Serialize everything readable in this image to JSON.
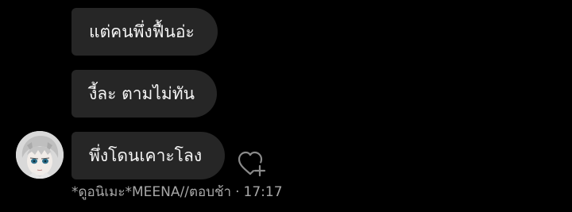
{
  "messages": [
    {
      "text": "แต่คนพึ่งฟื้นอ่ะ"
    },
    {
      "text": "งี้ละ ตามไม่ทัน"
    },
    {
      "text": "พึ่งโดนเคาะโลง"
    }
  ],
  "sender": {
    "name": "*ดูอนิเมะ*MEENA//ตอบช้า",
    "time": "17:17",
    "separator": "·"
  },
  "icons": {
    "react": "heart-plus-icon"
  },
  "colors": {
    "background": "#000000",
    "bubble": "#262626",
    "text": "#f5f5f5",
    "meta": "#a8a8a8"
  }
}
